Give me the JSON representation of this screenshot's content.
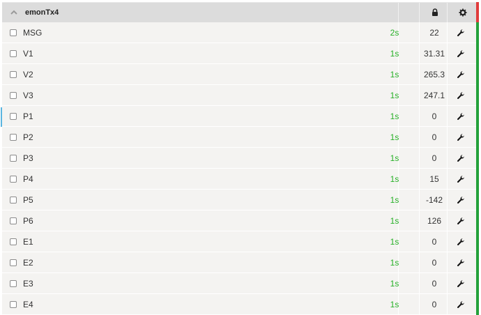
{
  "node": {
    "name": "emonTx4",
    "header_status_color": "#e03c3c",
    "icons": [
      "chevron-up-icon",
      "lock-icon",
      "gear-icon"
    ]
  },
  "feeds": [
    {
      "key": "MSG",
      "age": "2s",
      "value": "22"
    },
    {
      "key": "V1",
      "age": "1s",
      "value": "31.31"
    },
    {
      "key": "V2",
      "age": "1s",
      "value": "265.3"
    },
    {
      "key": "V3",
      "age": "1s",
      "value": "247.1"
    },
    {
      "key": "P1",
      "age": "1s",
      "value": "0"
    },
    {
      "key": "P2",
      "age": "1s",
      "value": "0"
    },
    {
      "key": "P3",
      "age": "1s",
      "value": "0"
    },
    {
      "key": "P4",
      "age": "1s",
      "value": "15"
    },
    {
      "key": "P5",
      "age": "1s",
      "value": "-142"
    },
    {
      "key": "P6",
      "age": "1s",
      "value": "126"
    },
    {
      "key": "E1",
      "age": "1s",
      "value": "0"
    },
    {
      "key": "E2",
      "age": "1s",
      "value": "0"
    },
    {
      "key": "E3",
      "age": "1s",
      "value": "0"
    },
    {
      "key": "E4",
      "age": "1s",
      "value": "0"
    }
  ],
  "row_status_color": "#23a13a",
  "age_color": "#27b027"
}
